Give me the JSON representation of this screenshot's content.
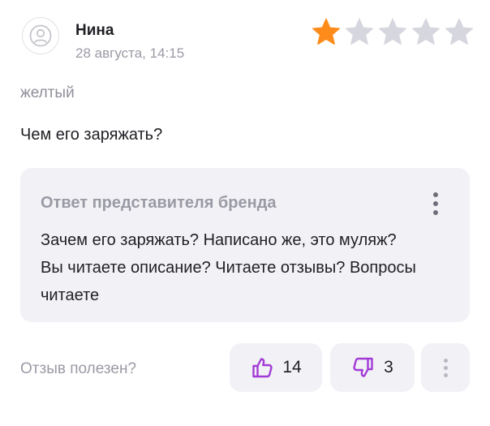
{
  "review": {
    "author": "Нина",
    "date": "28 августа, 14:15",
    "rating": 1,
    "max_rating": 5,
    "variant": "желтый",
    "text": "Чем его заряжать?"
  },
  "reply": {
    "title": "Ответ представителя бренда",
    "text": "Зачем его заряжать? Написано же, это муляж? Вы читаете описание? Читаете отзывы? Вопросы читаете"
  },
  "feedback": {
    "label": "Отзыв полезен?",
    "likes": "14",
    "dislikes": "3"
  },
  "colors": {
    "star_filled": "#ff8c1a",
    "star_empty": "#d6d6df",
    "accent": "#a23bd6"
  },
  "icons": {
    "avatar": "user-icon",
    "like": "thumbs-up-icon",
    "dislike": "thumbs-down-icon",
    "menu": "more-vertical-icon"
  }
}
